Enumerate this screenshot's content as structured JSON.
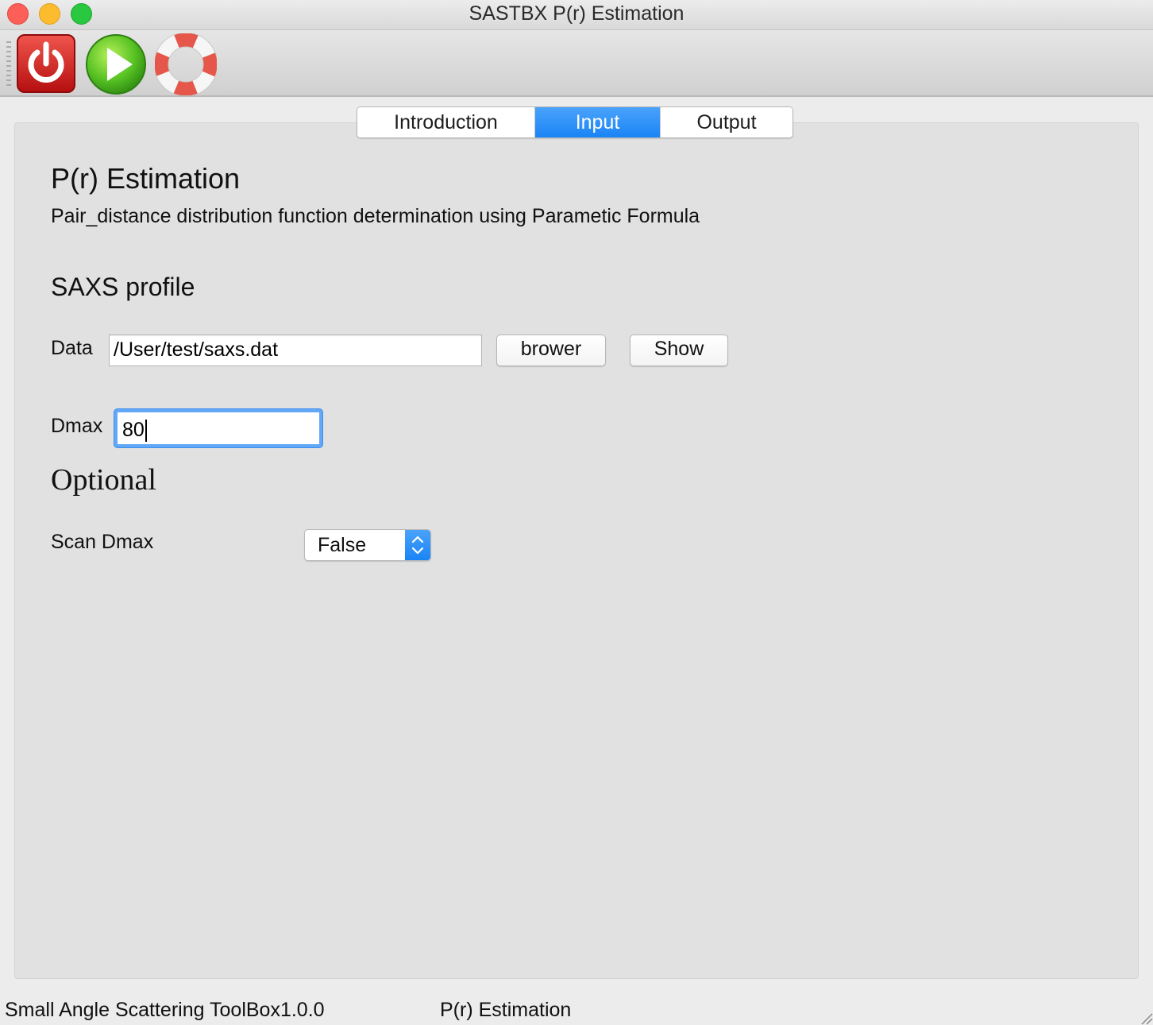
{
  "window": {
    "title": "SASTBX P(r) Estimation"
  },
  "toolbar": {
    "icons": [
      "power-icon",
      "run-icon",
      "help-lifebuoy-icon"
    ]
  },
  "tabs": [
    {
      "label": "Introduction",
      "active": false
    },
    {
      "label": "Input",
      "active": true
    },
    {
      "label": "Output",
      "active": false
    }
  ],
  "page": {
    "title": "P(r) Estimation",
    "subtitle": "Pair_distance distribution function determination using Parametic Formula"
  },
  "saxs": {
    "heading": "SAXS profile",
    "data_label": "Data",
    "data_value": "/User/test/saxs.dat",
    "brower_label": "brower",
    "show_label": "Show",
    "dmax_label": "Dmax",
    "dmax_value": "80"
  },
  "optional": {
    "heading": "Optional",
    "scan_label": "Scan Dmax",
    "scan_value": "False"
  },
  "status": {
    "left": "Small Angle Scattering ToolBox1.0.0",
    "right": "P(r) Estimation"
  },
  "colors": {
    "accent": "#1a84f5",
    "focus_ring": "#62a8f7",
    "panel_bg": "#e1e1e1"
  }
}
